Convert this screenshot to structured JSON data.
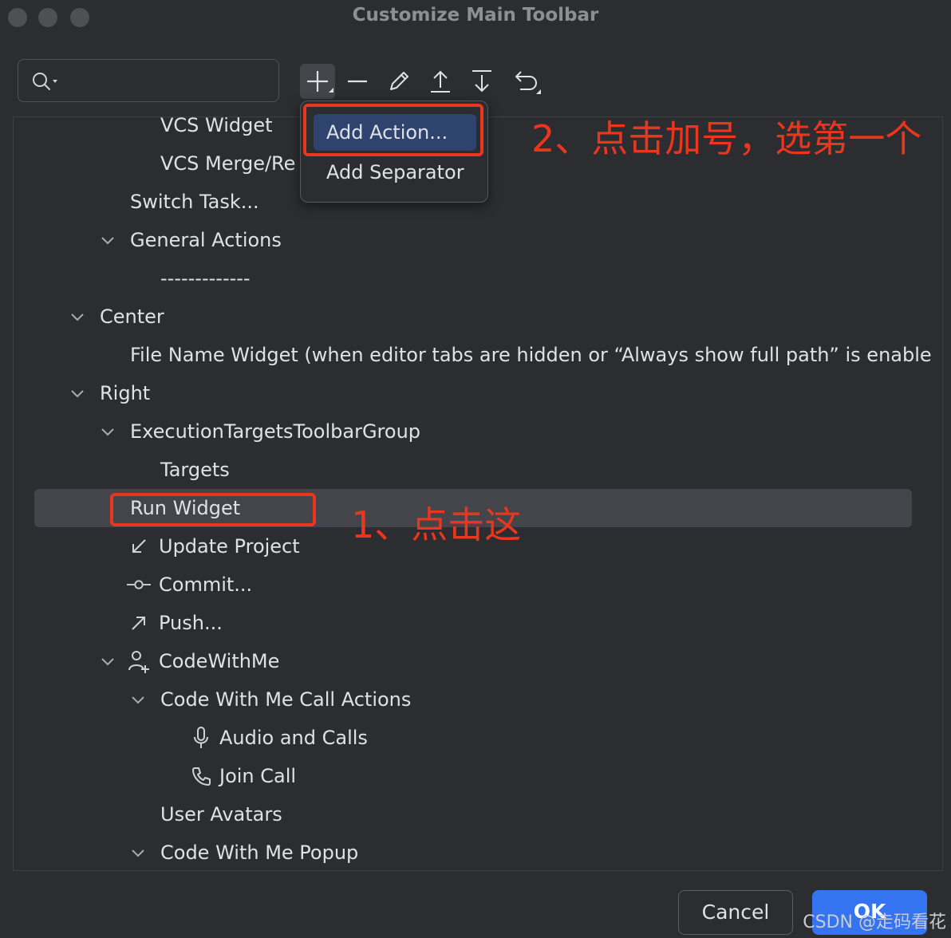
{
  "window": {
    "title": "Customize Main Toolbar"
  },
  "search": {
    "placeholder": ""
  },
  "toolbar_icons": [
    "plus-icon",
    "minus-icon",
    "pencil-icon",
    "move-up-icon",
    "move-down-icon",
    "undo-icon"
  ],
  "tree": {
    "rows": [
      {
        "label": "VCS Widget"
      },
      {
        "label": "VCS Merge/Re"
      },
      {
        "label": "Switch Task..."
      },
      {
        "label": "General Actions"
      },
      {
        "label": "-------------"
      },
      {
        "label": "Center"
      },
      {
        "label": "File Name Widget (when editor tabs are hidden or “Always show full path” is enable"
      },
      {
        "label": "Right"
      },
      {
        "label": "ExecutionTargetsToolbarGroup"
      },
      {
        "label": "Targets"
      },
      {
        "label": "Run Widget"
      },
      {
        "label": "Update Project"
      },
      {
        "label": "Commit..."
      },
      {
        "label": "Push..."
      },
      {
        "label": "CodeWithMe"
      },
      {
        "label": "Code With Me Call Actions"
      },
      {
        "label": "Audio and Calls"
      },
      {
        "label": "Join Call"
      },
      {
        "label": "User Avatars"
      },
      {
        "label": "Code With Me Popup"
      }
    ]
  },
  "popup": {
    "add_action": "Add Action...",
    "add_separator": "Add Separator"
  },
  "annotations": {
    "step2": "2、点击加号，选第一个",
    "step1": "1、点击这"
  },
  "buttons": {
    "cancel": "Cancel",
    "ok": "OK"
  },
  "watermark": "CSDN @走码看花",
  "colors": {
    "background": "#2b2d30",
    "selection": "#43454a",
    "popup_highlight": "#2e436e",
    "annotation_red": "#e9361d",
    "ok_blue": "#3574f0"
  }
}
